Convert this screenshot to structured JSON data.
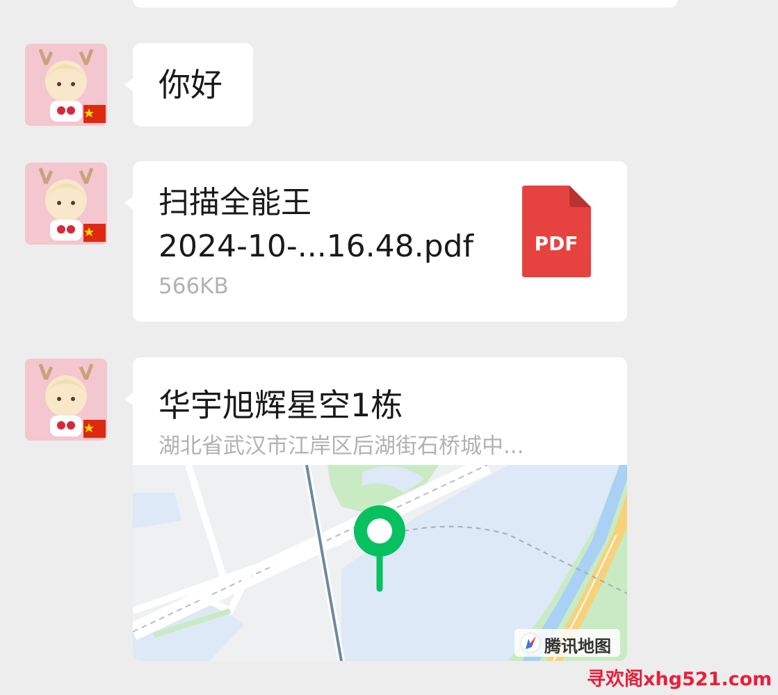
{
  "messages": {
    "greeting": {
      "text": "你好"
    },
    "file": {
      "name_line1": "扫描全能王",
      "name_line2": "2024-10-...16.48.pdf",
      "size": "566KB",
      "icon_label": "PDF",
      "icon_color": "#e64340"
    },
    "location": {
      "title": "华宇旭辉星空1栋",
      "address": "湖北省武汉市江岸区后湖街石桥城中...",
      "map_provider": "腾讯地图",
      "pin_color": "#07c160"
    }
  },
  "watermark": "寻欢阁xhg521.com",
  "colors": {
    "background": "#ededed",
    "bubble": "#ffffff",
    "secondary_text": "#b2b2b2"
  }
}
